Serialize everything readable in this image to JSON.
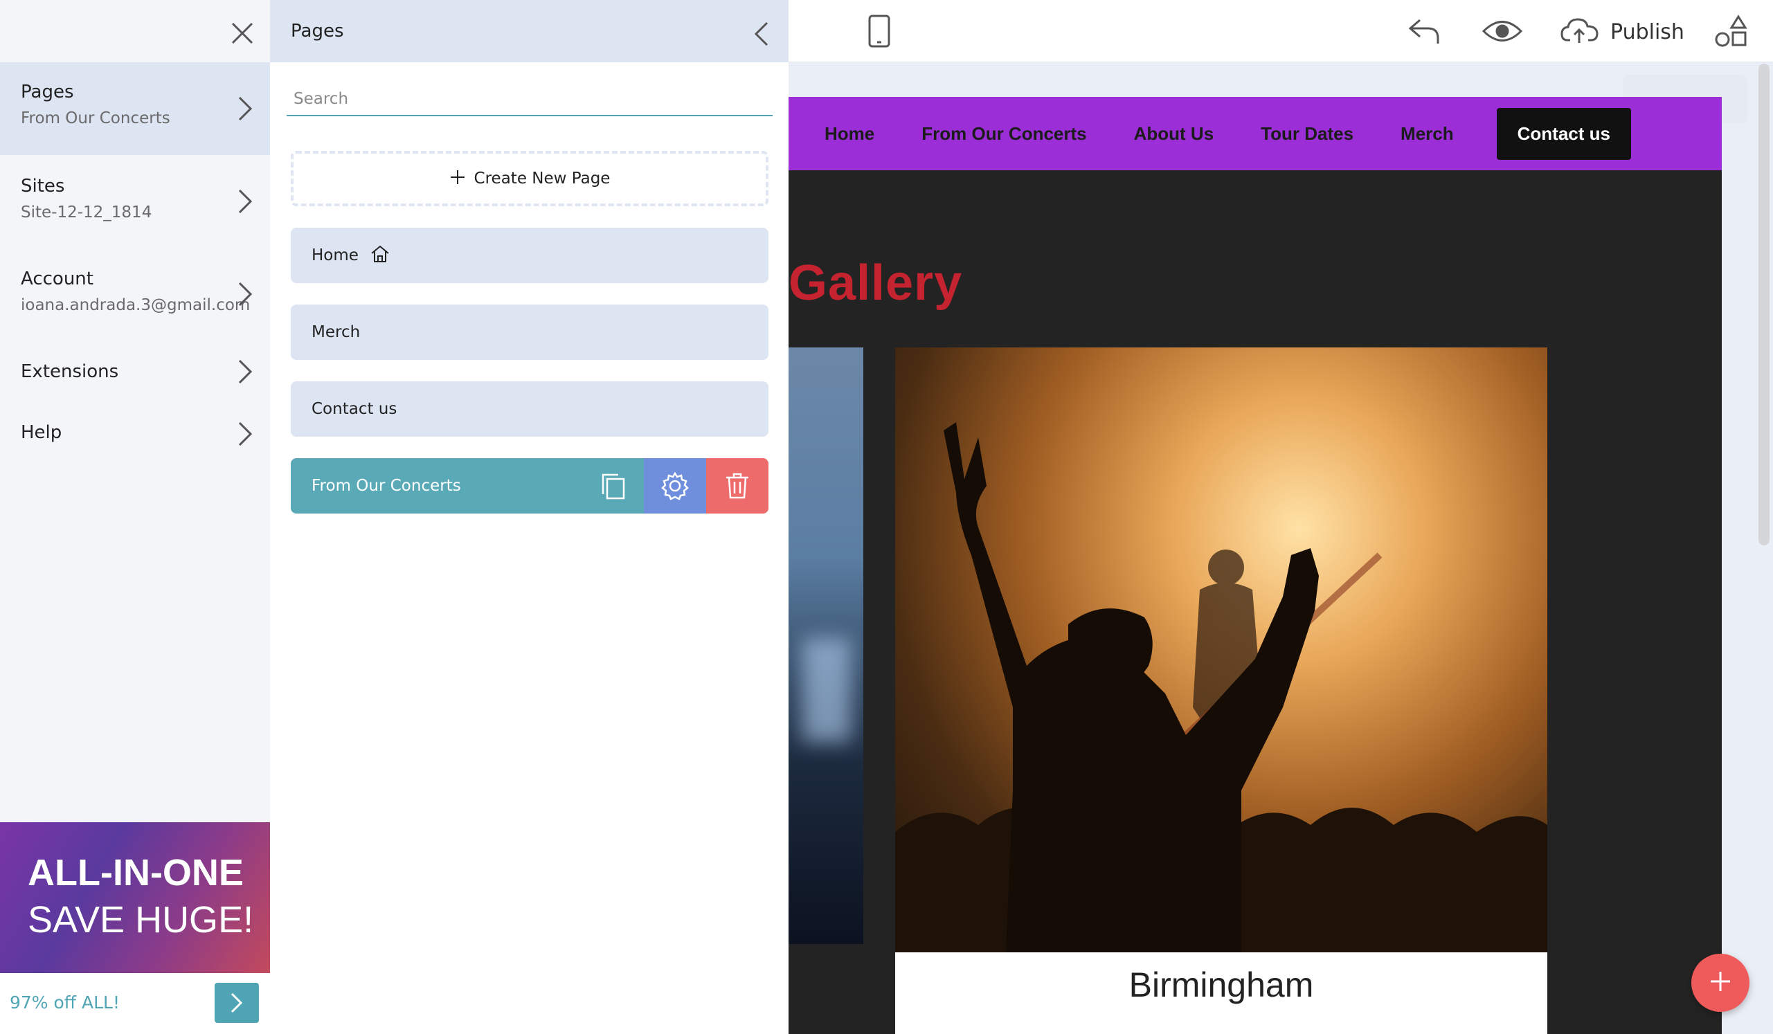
{
  "toolbar": {
    "publish_label": "Publish",
    "icons": [
      "mobile-device-icon",
      "undo-icon",
      "preview-eye-icon",
      "cloud-upload-icon",
      "shapes-icon"
    ]
  },
  "left_menu": {
    "items": [
      {
        "title": "Pages",
        "subtitle": "From Our Concerts"
      },
      {
        "title": "Sites",
        "subtitle": "Site-12-12_1814"
      },
      {
        "title": "Account",
        "subtitle": "ioana.andrada.3@gmail.com"
      },
      {
        "title": "Extensions",
        "subtitle": ""
      },
      {
        "title": "Help",
        "subtitle": ""
      }
    ],
    "promo": {
      "line1": "ALL-IN-ONE",
      "line2": "SAVE HUGE!",
      "footer": "97% off ALL!"
    }
  },
  "pages_panel": {
    "title": "Pages",
    "search_placeholder": "Search",
    "create_label": "Create New Page",
    "pages": [
      {
        "label": "Home"
      },
      {
        "label": "Merch"
      },
      {
        "label": "Contact us"
      },
      {
        "label": "From Our Concerts"
      }
    ]
  },
  "site": {
    "nav": [
      "Home",
      "From Our Concerts",
      "About Us",
      "Tour Dates",
      "Merch"
    ],
    "contact_button": "Contact us",
    "gallery_title": "Gallery",
    "card_title": "Birmingham"
  },
  "colors": {
    "accent": "#4fa5b4",
    "nav_bg": "#9b2ed6",
    "gallery_title": "#c4232f",
    "delete": "#ee6b6b",
    "settings": "#6f8fdc",
    "fab": "#ef5b5b"
  }
}
